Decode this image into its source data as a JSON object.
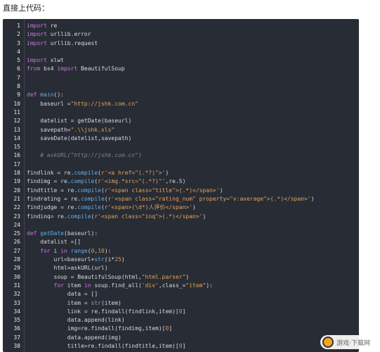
{
  "heading": "直接上代码：",
  "watermark": {
    "text": "游戏·下载网"
  },
  "lines": [
    {
      "num": "1",
      "tokens": [
        {
          "t": "kw",
          "v": "import"
        },
        {
          "t": "p",
          "v": " re"
        }
      ]
    },
    {
      "num": "2",
      "tokens": [
        {
          "t": "kw",
          "v": "import"
        },
        {
          "t": "p",
          "v": " urllib.error"
        }
      ]
    },
    {
      "num": "3",
      "tokens": [
        {
          "t": "kw",
          "v": "import"
        },
        {
          "t": "p",
          "v": " urllib.request"
        }
      ]
    },
    {
      "num": "4",
      "tokens": []
    },
    {
      "num": "5",
      "tokens": [
        {
          "t": "kw",
          "v": "import"
        },
        {
          "t": "p",
          "v": " xlwt"
        }
      ]
    },
    {
      "num": "6",
      "tokens": [
        {
          "t": "kw",
          "v": "from"
        },
        {
          "t": "p",
          "v": " bs4 "
        },
        {
          "t": "kw",
          "v": "import"
        },
        {
          "t": "p",
          "v": " BeautifulSoup"
        }
      ]
    },
    {
      "num": "7",
      "tokens": []
    },
    {
      "num": "8",
      "tokens": []
    },
    {
      "num": "9",
      "tokens": [
        {
          "t": "kw",
          "v": "def"
        },
        {
          "t": "p",
          "v": " "
        },
        {
          "t": "fn",
          "v": "main"
        },
        {
          "t": "p",
          "v": "():"
        }
      ]
    },
    {
      "num": "10",
      "tokens": [
        {
          "t": "p",
          "v": "    baseurl ="
        },
        {
          "t": "str",
          "v": "\"http://jshk.com.cn\""
        }
      ]
    },
    {
      "num": "11",
      "tokens": []
    },
    {
      "num": "12",
      "tokens": [
        {
          "t": "p",
          "v": "    datelist = getDate(baseurl)"
        }
      ]
    },
    {
      "num": "13",
      "tokens": [
        {
          "t": "p",
          "v": "    savepath="
        },
        {
          "t": "str",
          "v": "\".\\\\jshk.xls\""
        }
      ]
    },
    {
      "num": "14",
      "tokens": [
        {
          "t": "p",
          "v": "    saveDate(datelist,savepath)"
        }
      ]
    },
    {
      "num": "15",
      "tokens": []
    },
    {
      "num": "16",
      "tokens": [
        {
          "t": "cm",
          "v": "    # askURL(\"http://jshk.com.cn\")"
        }
      ]
    },
    {
      "num": "17",
      "tokens": []
    },
    {
      "num": "18",
      "tokens": [
        {
          "t": "p",
          "v": "findlink = re."
        },
        {
          "t": "fn",
          "v": "compile"
        },
        {
          "t": "p",
          "v": "("
        },
        {
          "t": "str",
          "v": "r'<a href=\"(.*?)\">'"
        },
        {
          "t": "p",
          "v": ")"
        }
      ]
    },
    {
      "num": "19",
      "tokens": [
        {
          "t": "p",
          "v": "findimg = re."
        },
        {
          "t": "fn",
          "v": "compile"
        },
        {
          "t": "p",
          "v": "("
        },
        {
          "t": "str",
          "v": "r'<img.*src=\"(.*?)\"'"
        },
        {
          "t": "p",
          "v": ",re.S)"
        }
      ]
    },
    {
      "num": "20",
      "tokens": [
        {
          "t": "p",
          "v": "findtitle = re."
        },
        {
          "t": "fn",
          "v": "compile"
        },
        {
          "t": "p",
          "v": "("
        },
        {
          "t": "str",
          "v": "r'<span class=\"title\">(.*)</span>'"
        },
        {
          "t": "p",
          "v": ")"
        }
      ]
    },
    {
      "num": "21",
      "tokens": [
        {
          "t": "p",
          "v": "findrating = re."
        },
        {
          "t": "fn",
          "v": "compile"
        },
        {
          "t": "p",
          "v": "("
        },
        {
          "t": "str",
          "v": "r'<span class=\"rating_num\" property=\"v:average\">(.*)</span>'"
        },
        {
          "t": "p",
          "v": ")"
        }
      ]
    },
    {
      "num": "22",
      "tokens": [
        {
          "t": "p",
          "v": "findjudge = re."
        },
        {
          "t": "fn",
          "v": "compile"
        },
        {
          "t": "p",
          "v": "("
        },
        {
          "t": "str",
          "v": "r'<span>(\\d*)人评价</span>'"
        },
        {
          "t": "p",
          "v": ")"
        }
      ]
    },
    {
      "num": "23",
      "tokens": [
        {
          "t": "p",
          "v": "findinq= re."
        },
        {
          "t": "fn",
          "v": "compile"
        },
        {
          "t": "p",
          "v": "("
        },
        {
          "t": "str",
          "v": "r'<span class=\"inq\">(.*)</span>'"
        },
        {
          "t": "p",
          "v": ")"
        }
      ]
    },
    {
      "num": "24",
      "tokens": []
    },
    {
      "num": "25",
      "tokens": [
        {
          "t": "kw",
          "v": "def"
        },
        {
          "t": "p",
          "v": " "
        },
        {
          "t": "fn",
          "v": "getDate"
        },
        {
          "t": "p",
          "v": "(baseurl):"
        }
      ]
    },
    {
      "num": "26",
      "tokens": [
        {
          "t": "p",
          "v": "    datalist =[]"
        }
      ]
    },
    {
      "num": "27",
      "tokens": [
        {
          "t": "p",
          "v": "    "
        },
        {
          "t": "kw",
          "v": "for"
        },
        {
          "t": "p",
          "v": " i "
        },
        {
          "t": "kw",
          "v": "in"
        },
        {
          "t": "p",
          "v": " "
        },
        {
          "t": "fn",
          "v": "range"
        },
        {
          "t": "p",
          "v": "("
        },
        {
          "t": "num",
          "v": "0"
        },
        {
          "t": "p",
          "v": ","
        },
        {
          "t": "num",
          "v": "10"
        },
        {
          "t": "p",
          "v": "):"
        }
      ]
    },
    {
      "num": "28",
      "tokens": [
        {
          "t": "p",
          "v": "        url=baseurl+"
        },
        {
          "t": "fn",
          "v": "str"
        },
        {
          "t": "p",
          "v": "(i*"
        },
        {
          "t": "num",
          "v": "25"
        },
        {
          "t": "p",
          "v": ")"
        }
      ]
    },
    {
      "num": "29",
      "tokens": [
        {
          "t": "p",
          "v": "        html=askURL(url)"
        }
      ]
    },
    {
      "num": "30",
      "tokens": [
        {
          "t": "p",
          "v": "        soup = BeautifulSoup(html,"
        },
        {
          "t": "str",
          "v": "\"html.parser\""
        },
        {
          "t": "p",
          "v": ")"
        }
      ]
    },
    {
      "num": "31",
      "tokens": [
        {
          "t": "p",
          "v": "        "
        },
        {
          "t": "kw",
          "v": "for"
        },
        {
          "t": "p",
          "v": " item "
        },
        {
          "t": "kw",
          "v": "in"
        },
        {
          "t": "p",
          "v": " soup.find_all("
        },
        {
          "t": "str",
          "v": "'div'"
        },
        {
          "t": "p",
          "v": ",class_="
        },
        {
          "t": "str",
          "v": "\"item\""
        },
        {
          "t": "p",
          "v": "):"
        }
      ]
    },
    {
      "num": "32",
      "tokens": [
        {
          "t": "p",
          "v": "            data = []"
        }
      ]
    },
    {
      "num": "33",
      "tokens": [
        {
          "t": "p",
          "v": "            item = "
        },
        {
          "t": "fn",
          "v": "str"
        },
        {
          "t": "p",
          "v": "(item)"
        }
      ]
    },
    {
      "num": "34",
      "tokens": [
        {
          "t": "p",
          "v": "            link = re.findall(findlink,item)["
        },
        {
          "t": "num",
          "v": "0"
        },
        {
          "t": "p",
          "v": "]"
        }
      ]
    },
    {
      "num": "35",
      "tokens": [
        {
          "t": "p",
          "v": "            data.append(link)"
        }
      ]
    },
    {
      "num": "36",
      "tokens": [
        {
          "t": "p",
          "v": "            img=re.findall(findimg,item)["
        },
        {
          "t": "num",
          "v": "0"
        },
        {
          "t": "p",
          "v": "]"
        }
      ]
    },
    {
      "num": "37",
      "tokens": [
        {
          "t": "p",
          "v": "            data.append(img)"
        }
      ]
    },
    {
      "num": "38",
      "tokens": [
        {
          "t": "p",
          "v": "            title=re.findall(findtitle,item)["
        },
        {
          "t": "num",
          "v": "0"
        },
        {
          "t": "p",
          "v": "]"
        }
      ]
    }
  ]
}
